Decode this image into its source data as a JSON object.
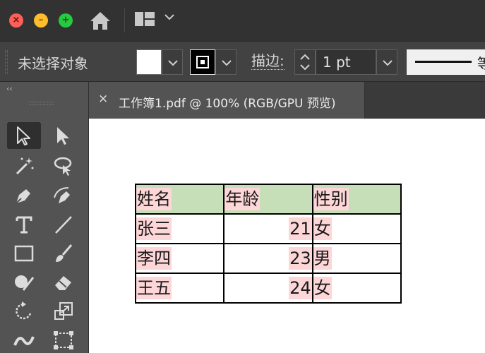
{
  "window": {
    "buttons": [
      "close",
      "minimize",
      "maximize"
    ]
  },
  "control_bar": {
    "selection_label": "未选择对象",
    "stroke_label": "描边:",
    "stroke_weight": "1 pt",
    "line_style_label": "等"
  },
  "document": {
    "tab_close": "×",
    "tab_title": "工作簿1.pdf @ 100% (RGB/GPU 预览)"
  },
  "toolbar": {
    "collapse": "‹‹",
    "tools": [
      "selection-tool",
      "direct-selection-tool",
      "magic-wand-tool",
      "lasso-tool",
      "pen-tool",
      "curvature-tool",
      "type-tool",
      "line-segment-tool",
      "rectangle-tool",
      "paintbrush-tool",
      "shaper-tool",
      "eraser-tool",
      "rotate-tool",
      "scale-tool",
      "width-tool",
      "free-transform-tool"
    ]
  },
  "table": {
    "headers": [
      "姓名",
      "年龄",
      "性别"
    ],
    "rows": [
      [
        "张三",
        "21",
        "女"
      ],
      [
        "李四",
        "23",
        "男"
      ],
      [
        "王五",
        "24",
        "女"
      ]
    ]
  },
  "colors": {
    "header_fill": "#c6dfb8",
    "text_highlight": "#fdd6d8",
    "app_bg": "#535353"
  }
}
